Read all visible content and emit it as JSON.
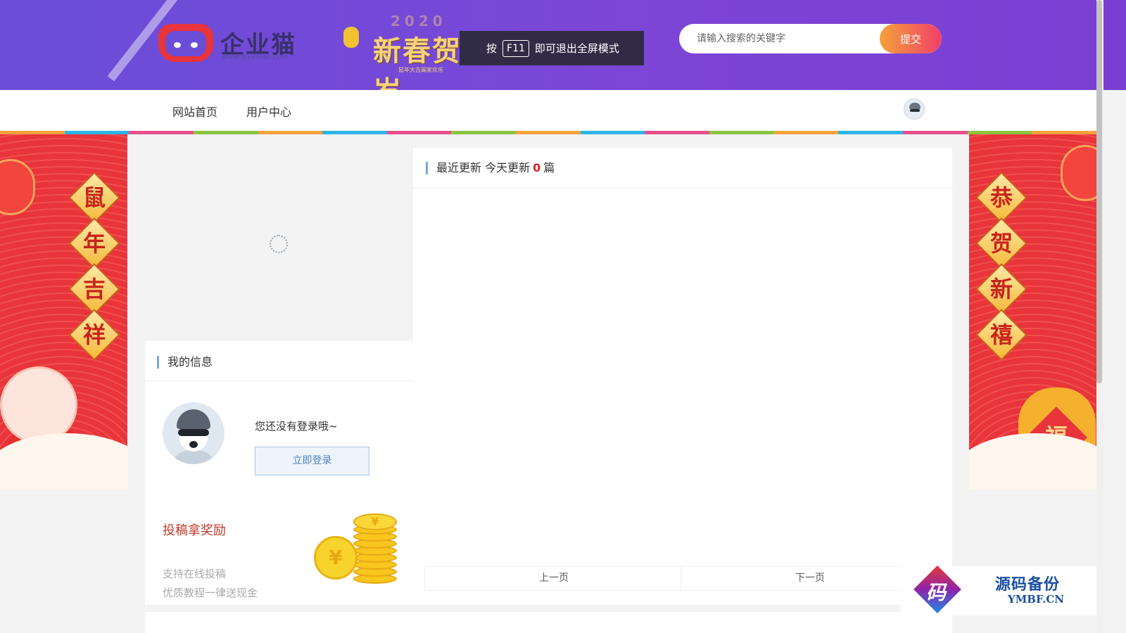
{
  "header": {
    "logo_text": "企业猫",
    "logo_url": "www.qiyemao.com",
    "banner_year": "2020",
    "banner_text": "新春贺岁",
    "banner_sub": "鼠年大吉阖家欢乐",
    "fullscreen_tip": {
      "prefix": "按",
      "key": "F11",
      "suffix": "即可退出全屏模式"
    },
    "search": {
      "placeholder": "请输入搜索的关键字",
      "value": "",
      "button_label": "提交"
    }
  },
  "nav": {
    "items": [
      {
        "label": "网站首页"
      },
      {
        "label": "用户中心"
      }
    ]
  },
  "color_bar": [
    "#f7a33b",
    "#2bb6e6",
    "#e94e8c",
    "#8bc53f",
    "#f7a33b",
    "#2bb6e6",
    "#e94e8c",
    "#8bc53f",
    "#f7a33b",
    "#2bb6e6",
    "#e94e8c",
    "#8bc53f",
    "#f7a33b",
    "#2bb6e6",
    "#e94e8c",
    "#8bc53f",
    "#f7a33b"
  ],
  "banner_left": {
    "chars": [
      "鼠",
      "年",
      "吉",
      "祥"
    ]
  },
  "banner_right": {
    "chars": [
      "恭",
      "贺",
      "新",
      "禧"
    ],
    "bag_char": "福"
  },
  "my_info": {
    "title": "我的信息",
    "not_logged_text": "您还没有登录哦~",
    "login_button": "立即登录",
    "reward_title": "投稿拿奖励",
    "reward_lines": [
      "支持在线投稿",
      "优质教程一律送现金"
    ],
    "coin_symbol": "¥"
  },
  "updates": {
    "title_prefix": "最近更新 今天更新",
    "count": "0",
    "title_suffix": "篇",
    "prev_label": "上一页",
    "next_label": "下一页"
  },
  "watermark": {
    "mark_char": "码",
    "text": "源码备份",
    "sub": "YMBF.CN"
  }
}
